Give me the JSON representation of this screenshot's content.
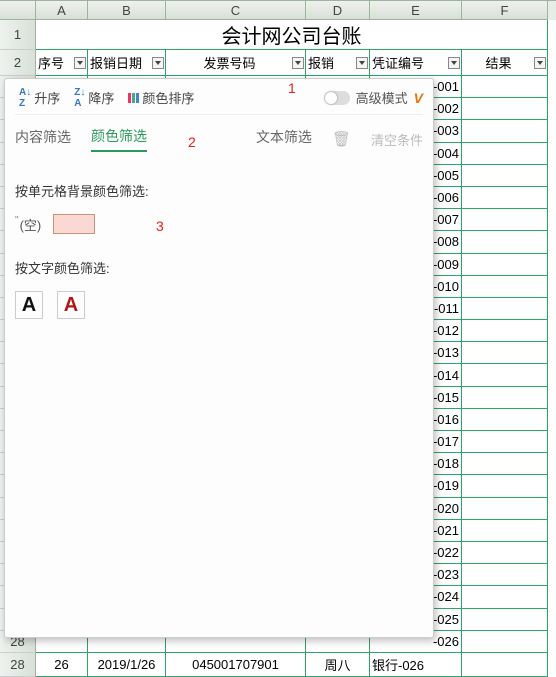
{
  "columns": {
    "A": "A",
    "B": "B",
    "C": "C",
    "D": "D",
    "E": "E",
    "F": "F"
  },
  "title": "会计网公司台账",
  "headers": {
    "A": "序号",
    "B": "报销日期",
    "C": "发票号码",
    "D": "报销",
    "E": "凭证编号",
    "F": "结果"
  },
  "annotations": {
    "a1": "1",
    "a2": "2",
    "a3": "3"
  },
  "popup": {
    "sort_asc": "升序",
    "sort_desc": "降序",
    "color_sort": "颜色排序",
    "advanced": "高级模式",
    "tab_content": "内容筛选",
    "tab_color": "颜色筛选",
    "tab_text": "文本筛选",
    "clear": "清空条件",
    "bg_title": "按单元格背景颜色筛选:",
    "empty": "(空)",
    "font_title": "按文字颜色筛选:",
    "glyph": "A"
  },
  "e_prefix": "-0",
  "visible_rows": [
    "01",
    "02",
    "03",
    "04",
    "05",
    "06",
    "07",
    "08",
    "09",
    "10",
    "11",
    "12",
    "13",
    "14",
    "15",
    "16",
    "17",
    "18",
    "19",
    "20",
    "21",
    "22",
    "23",
    "24",
    "25",
    "26"
  ],
  "bottom_row": {
    "num": "28",
    "A": "26",
    "B": "2019/1/26",
    "C": "045001707901",
    "D": "周八",
    "E": "银行-026"
  }
}
